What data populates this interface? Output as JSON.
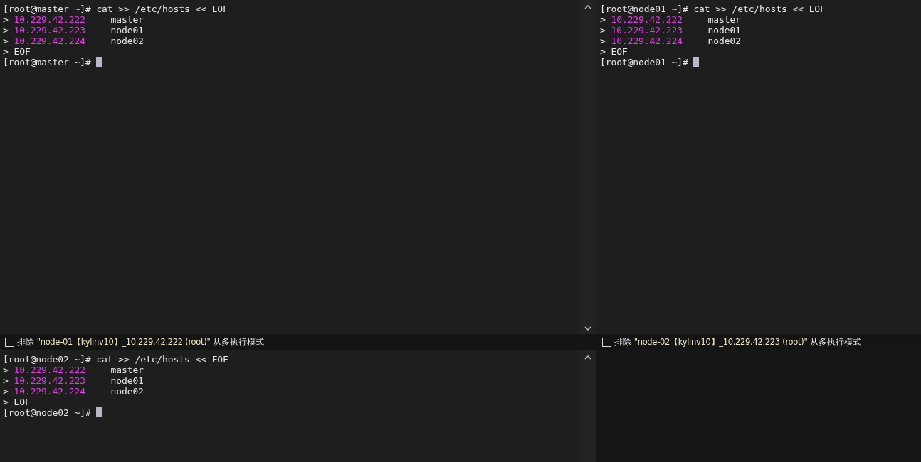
{
  "panes": [
    {
      "lines": [
        {
          "kind": "command",
          "prompt": "[root@master ~]#",
          "text": "cat >> /etc/hosts << EOF"
        },
        {
          "kind": "entry",
          "prefix": ">",
          "ip": "10.229.42.222",
          "host": "master"
        },
        {
          "kind": "entry",
          "prefix": ">",
          "ip": "10.229.42.223",
          "host": "node01"
        },
        {
          "kind": "entry",
          "prefix": ">",
          "ip": "10.229.42.224",
          "host": "node02"
        },
        {
          "kind": "plain",
          "text": "> EOF"
        },
        {
          "kind": "cursor",
          "prompt": "[root@master ~]#"
        }
      ],
      "exclude": {
        "checked": false,
        "label": "排除",
        "target": "\"node-01【kylinv10】_10.229.42.222 (root)\"",
        "suffix": "从多执行模式"
      }
    },
    {
      "lines": [
        {
          "kind": "command",
          "prompt": "[root@node01 ~]#",
          "text": "cat >> /etc/hosts << EOF"
        },
        {
          "kind": "entry",
          "prefix": ">",
          "ip": "10.229.42.222",
          "host": "master"
        },
        {
          "kind": "entry",
          "prefix": ">",
          "ip": "10.229.42.223",
          "host": "node01"
        },
        {
          "kind": "entry",
          "prefix": ">",
          "ip": "10.229.42.224",
          "host": "node02"
        },
        {
          "kind": "plain",
          "text": "> EOF"
        },
        {
          "kind": "cursor",
          "prompt": "[root@node01 ~]#"
        }
      ],
      "exclude": {
        "checked": false,
        "label": "排除",
        "target": "\"node-02【kylinv10】_10.229.42.223 (root)\"",
        "suffix": "从多执行模式"
      }
    },
    {
      "lines": [
        {
          "kind": "command",
          "prompt": "[root@node02 ~]#",
          "text": "cat >> /etc/hosts << EOF"
        },
        {
          "kind": "entry",
          "prefix": ">",
          "ip": "10.229.42.222",
          "host": "master"
        },
        {
          "kind": "entry",
          "prefix": ">",
          "ip": "10.229.42.223",
          "host": "node01"
        },
        {
          "kind": "entry",
          "prefix": ">",
          "ip": "10.229.42.224",
          "host": "node02"
        },
        {
          "kind": "plain",
          "text": "> EOF"
        },
        {
          "kind": "cursor",
          "prompt": "[root@node02 ~]#"
        }
      ]
    }
  ]
}
